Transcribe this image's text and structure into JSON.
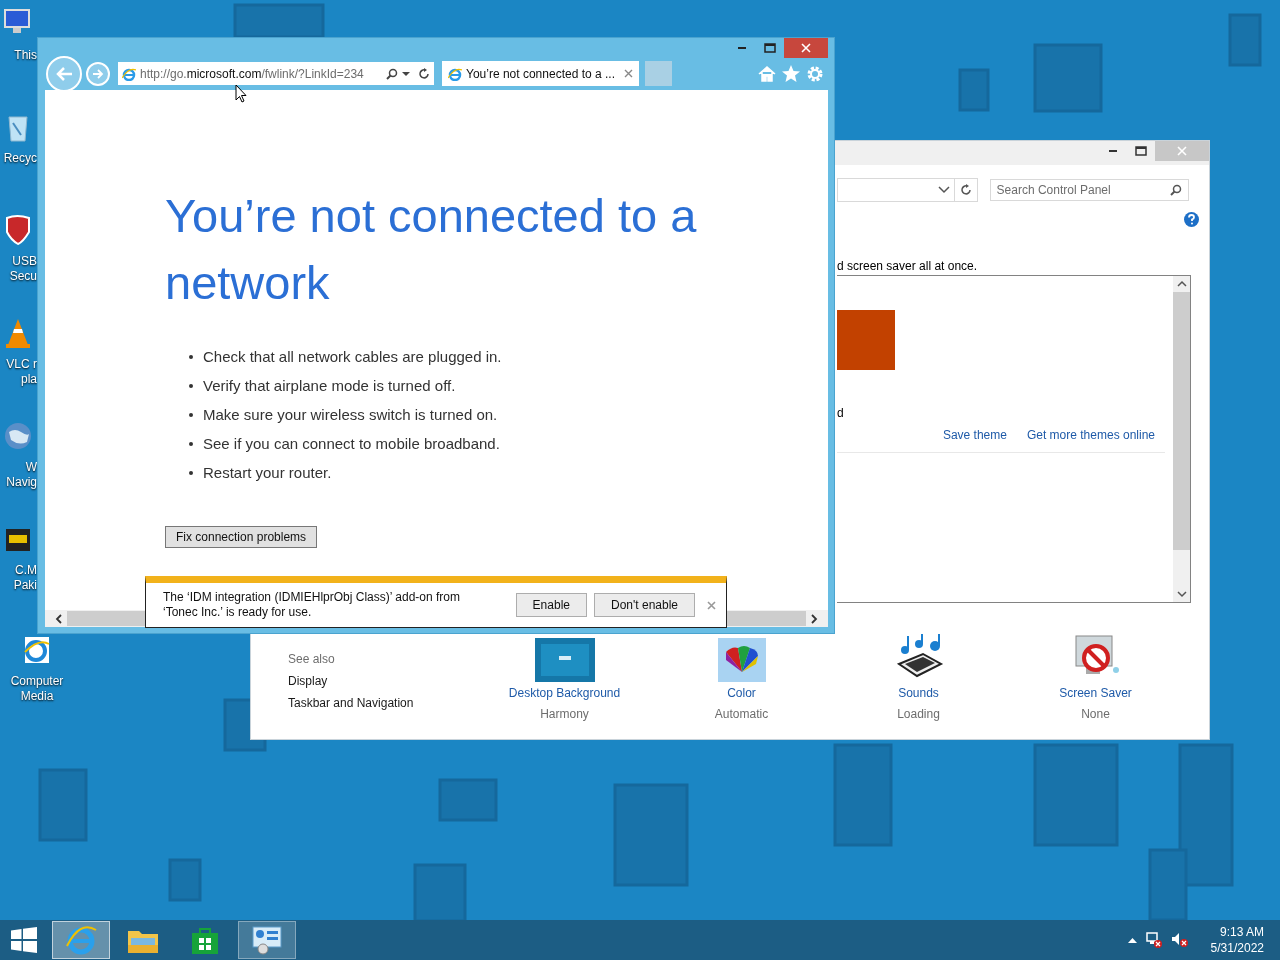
{
  "desktop_icons": [
    {
      "kind": "computer",
      "lines": [
        "This"
      ]
    },
    {
      "kind": "bin",
      "lines": [
        "Recyc"
      ]
    },
    {
      "kind": "shield",
      "lines": [
        "USB",
        "Secu"
      ]
    },
    {
      "kind": "cone",
      "lines": [
        "VLC r",
        "pla"
      ]
    },
    {
      "kind": "globe",
      "lines": [
        "W",
        "Navig"
      ]
    },
    {
      "kind": "media",
      "lines": [
        "C.M",
        "Paki"
      ]
    },
    {
      "kind": "ie",
      "lines": [
        "Computer",
        "Media"
      ]
    }
  ],
  "control_panel": {
    "search": {
      "placeholder": "Search Control Panel"
    },
    "description": "d screen saver all at once.",
    "theme_caption": "d",
    "links": [
      "Save theme",
      "Get more themes online"
    ],
    "see_also": {
      "title": "See also",
      "links": [
        "Display",
        "Taskbar and Navigation"
      ]
    },
    "settings": [
      {
        "kind": "background",
        "label": "Desktop Background",
        "value": "Harmony"
      },
      {
        "kind": "color",
        "label": "Color",
        "value": "Automatic"
      },
      {
        "kind": "sounds",
        "label": "Sounds",
        "value": "Loading"
      },
      {
        "kind": "screensaver",
        "label": "Screen Saver",
        "value": "None"
      }
    ]
  },
  "browser": {
    "address": "http://go.**microsoft.com**/fwlink/?LinkId=234",
    "tabs": [
      {
        "title": "You’re not connected to a ...",
        "selected": true
      }
    ],
    "heading": "You’re not connected to a network",
    "tips": [
      "Check that all network cables are plugged in.",
      "Verify that airplane mode is turned off.",
      "Make sure your wireless switch is turned on.",
      "See if you can connect to mobile broadband.",
      "Restart your router."
    ],
    "fix_button": "Fix connection problems",
    "notification": {
      "message": "The ‘IDM integration (IDMIEHlprObj Class)’ add-on from ‘Tonec Inc.’ is ready for use.",
      "buttons": [
        "Enable",
        "Don't enable"
      ]
    }
  },
  "taskbar": {
    "apps": [
      {
        "kind": "ie",
        "running": true,
        "selected": true
      },
      {
        "kind": "explorer",
        "running": false,
        "selected": false
      },
      {
        "kind": "store",
        "running": false,
        "selected": false
      },
      {
        "kind": "control-panel",
        "running": true,
        "selected": false
      }
    ],
    "time": "9:13 AM",
    "date": "5/31/2022"
  }
}
